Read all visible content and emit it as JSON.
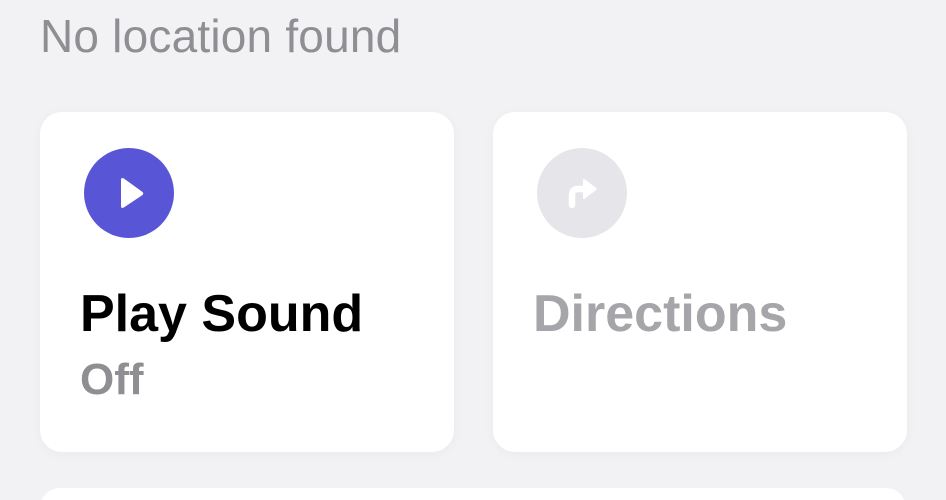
{
  "status": {
    "location_text": "No location found"
  },
  "actions": {
    "play_sound": {
      "title": "Play Sound",
      "state": "Off",
      "icon": "play-icon",
      "icon_color": "#5856d6",
      "enabled": true
    },
    "directions": {
      "title": "Directions",
      "icon": "turn-right-arrow-icon",
      "icon_color": "#e5e5ea",
      "enabled": false
    }
  }
}
